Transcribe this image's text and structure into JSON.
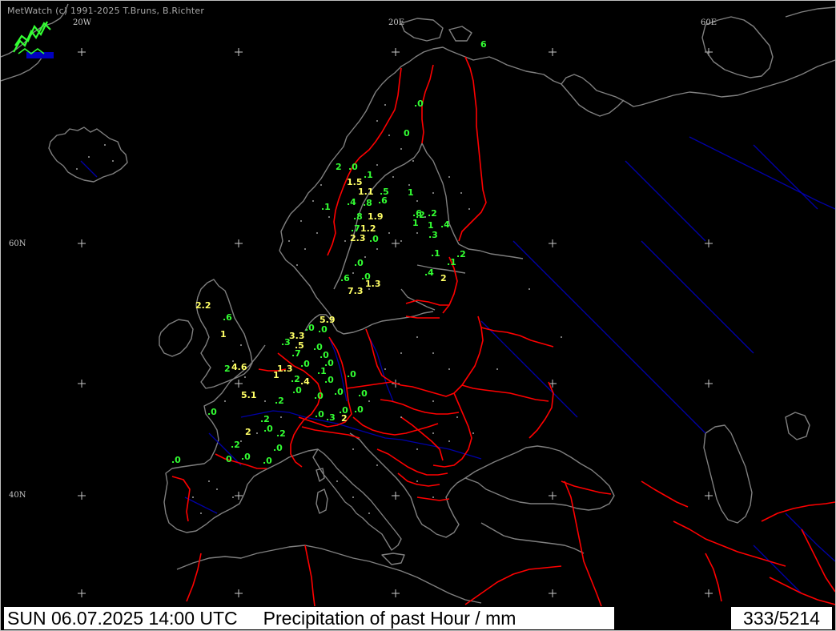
{
  "app": {
    "credit": "MetWatch  (c) 1991-2025 T.Bruns, B.Richter",
    "logo_icon": "metwatch-logo-icon"
  },
  "grid_labels": {
    "lon_20w": "20W",
    "lon_20e": "20E",
    "lon_60e": "60E",
    "lat_60n": "60N",
    "lat_40n": "40N"
  },
  "footer": {
    "datetime": "SUN 06.07.2025 14:00 UTC",
    "product": "Precipitation of past  Hour  / mm",
    "count": "333/5214"
  },
  "colors": {
    "coast": "#808080",
    "border": "#ff0000",
    "river": "#0000a0",
    "light_value": "#33ff33",
    "heavy_value": "#ffff66",
    "station_dot": "#cfcfcf"
  },
  "observations": [
    {
      "v": "6",
      "c": "g"
    },
    {
      "v": ".0",
      "c": "g"
    },
    {
      "v": "0",
      "c": "g"
    },
    {
      "v": "2",
      "c": "g"
    },
    {
      "v": ".0",
      "c": "g"
    },
    {
      "v": ".1",
      "c": "g"
    },
    {
      "v": "1.5",
      "c": "y"
    },
    {
      "v": "1.1",
      "c": "y"
    },
    {
      "v": ".5",
      "c": "g"
    },
    {
      "v": "1",
      "c": "g"
    },
    {
      "v": ".4",
      "c": "g"
    },
    {
      "v": ".8",
      "c": "g"
    },
    {
      "v": ".6",
      "c": "g"
    },
    {
      "v": "1",
      "c": "g"
    },
    {
      "v": ".8",
      "c": "g"
    },
    {
      "v": "1.9",
      "c": "y"
    },
    {
      "v": ".6",
      "c": "g"
    },
    {
      "v": ".2",
      "c": "g"
    },
    {
      "v": ".7",
      "c": "g"
    },
    {
      "v": "1.2",
      "c": "y"
    },
    {
      "v": "1",
      "c": "g"
    },
    {
      "v": ".4",
      "c": "g"
    },
    {
      "v": ".3",
      "c": "g"
    },
    {
      "v": "2.3",
      "c": "y"
    },
    {
      "v": ".0",
      "c": "g"
    },
    {
      "v": ".2",
      "c": "g"
    },
    {
      "v": ".1",
      "c": "g"
    },
    {
      "v": ".1",
      "c": "g"
    },
    {
      "v": ".2",
      "c": "g"
    },
    {
      "v": ".1",
      "c": "g"
    },
    {
      "v": ".0",
      "c": "g"
    },
    {
      "v": ".4",
      "c": "g"
    },
    {
      "v": "2",
      "c": "y"
    },
    {
      "v": ".6",
      "c": "g"
    },
    {
      "v": ".0",
      "c": "g"
    },
    {
      "v": "1.3",
      "c": "y"
    },
    {
      "v": "7.3",
      "c": "y"
    },
    {
      "v": "2.2",
      "c": "y"
    },
    {
      "v": ".6",
      "c": "g"
    },
    {
      "v": "5.9",
      "c": "y"
    },
    {
      "v": "1",
      "c": "y"
    },
    {
      "v": ".0",
      "c": "g"
    },
    {
      "v": ".0",
      "c": "g"
    },
    {
      "v": "3.3",
      "c": "y"
    },
    {
      "v": ".3",
      "c": "g"
    },
    {
      "v": ".5",
      "c": "y"
    },
    {
      "v": ".0",
      "c": "g"
    },
    {
      "v": ".7",
      "c": "g"
    },
    {
      "v": ".0",
      "c": "g"
    },
    {
      "v": ".0",
      "c": "g"
    },
    {
      "v": ".0",
      "c": "g"
    },
    {
      "v": "2",
      "c": "g"
    },
    {
      "v": "4.6",
      "c": "y"
    },
    {
      "v": "1.3",
      "c": "y"
    },
    {
      "v": ".1",
      "c": "g"
    },
    {
      "v": "1",
      "c": "y"
    },
    {
      "v": ".2",
      "c": "g"
    },
    {
      "v": ".4",
      "c": "y"
    },
    {
      "v": ".0",
      "c": "g"
    },
    {
      "v": ".0",
      "c": "g"
    },
    {
      "v": ".0",
      "c": "g"
    },
    {
      "v": "5.1",
      "c": "y"
    },
    {
      "v": ".2",
      "c": "g"
    },
    {
      "v": ".0",
      "c": "g"
    },
    {
      "v": ".0",
      "c": "g"
    },
    {
      "v": ".0",
      "c": "g"
    },
    {
      "v": ".0",
      "c": "g"
    },
    {
      "v": ".2",
      "c": "g"
    },
    {
      "v": ".0",
      "c": "g"
    },
    {
      "v": ".3",
      "c": "g"
    },
    {
      "v": "2",
      "c": "y"
    },
    {
      "v": ".0",
      "c": "g"
    },
    {
      "v": ".0",
      "c": "g"
    },
    {
      "v": "2",
      "c": "y"
    },
    {
      "v": ".0",
      "c": "g"
    },
    {
      "v": ".2",
      "c": "g"
    },
    {
      "v": ".2",
      "c": "g"
    },
    {
      "v": ".0",
      "c": "g"
    },
    {
      "v": "0",
      "c": "g"
    },
    {
      "v": ".0",
      "c": "g"
    },
    {
      "v": ".0",
      "c": "g"
    },
    {
      "v": ".0",
      "c": "g"
    }
  ]
}
